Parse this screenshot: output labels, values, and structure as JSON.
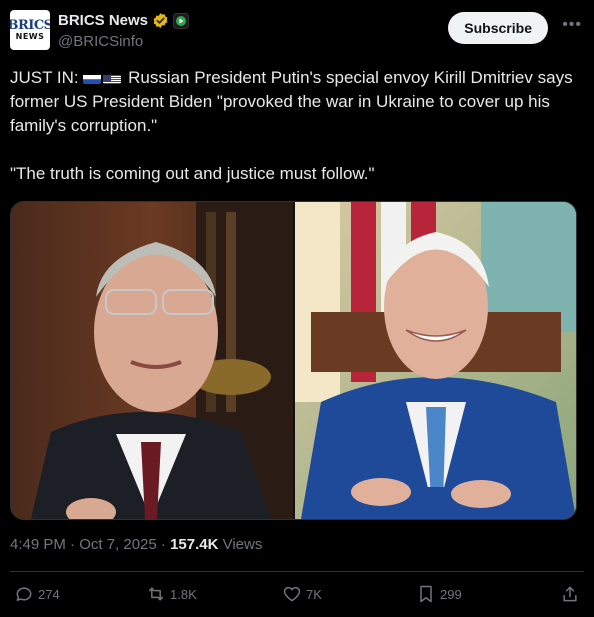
{
  "author": {
    "display_name": "BRICS News",
    "handle": "@BRICSinfo",
    "avatar_line1": "BRICS",
    "avatar_line2": "NEWS"
  },
  "header": {
    "subscribe_label": "Subscribe",
    "more_icon": "more-horizontal-icon"
  },
  "tweet": {
    "prefix": "JUST IN: ",
    "flags": [
      "russia-flag",
      "usa-flag"
    ],
    "body": " Russian President Putin's special envoy Kirill Dmitriev says former US President Biden \"provoked the war in Ukraine to cover up his family's corruption.\"\n\n\"The truth is coming out and justice must follow.\""
  },
  "meta": {
    "timestamp": "4:49 PM · Oct 7, 2025 · ",
    "views_count": "157.4K",
    "views_label": " Views"
  },
  "actions": {
    "replies": "274",
    "reposts": "1.8K",
    "likes": "7K",
    "bookmarks": "299"
  },
  "colors": {
    "background": "#000000",
    "text": "#e7e9ea",
    "muted": "#71767b",
    "verified_gold": "#e2b719"
  }
}
